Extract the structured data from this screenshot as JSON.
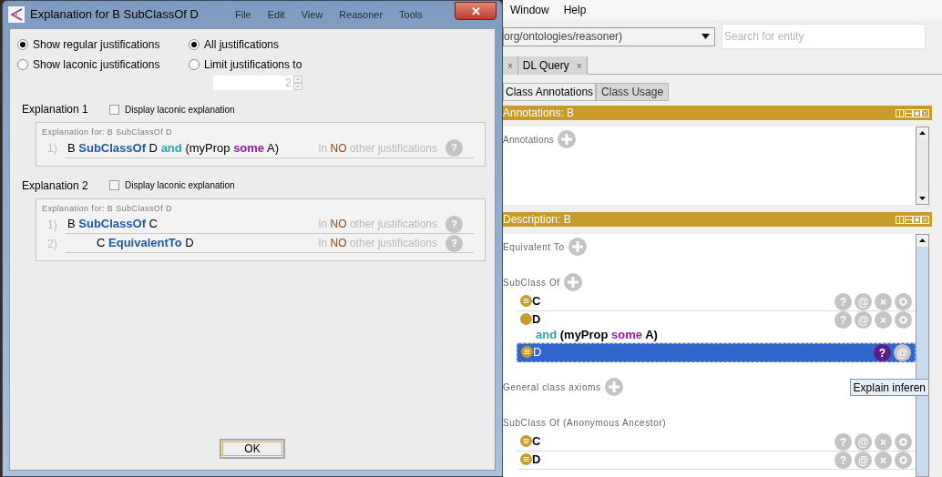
{
  "dialog": {
    "title": "Explanation for B SubClassOf D",
    "close_glyph": "✕",
    "background_menu": [
      "File",
      "Edit",
      "View",
      "Reasoner",
      "Tools"
    ],
    "options": [
      {
        "label": "Show regular justifications",
        "selected": true
      },
      {
        "label": "Show laconic justifications",
        "selected": false
      }
    ],
    "limits": [
      {
        "label": "All justifications",
        "selected": true
      },
      {
        "label": "Limit justifications to",
        "selected": false
      }
    ],
    "limit_value": "2",
    "explanations": [
      {
        "title": "Explanation 1",
        "laconic_label": "Display laconic explanation",
        "laconic_checked": false,
        "header": "Explanation for: B SubClassOf D",
        "axioms": [
          {
            "number": "1)",
            "parts": [
              {
                "text": "B",
                "kind": "name"
              },
              {
                "text": "SubClassOf",
                "kind": "keyword"
              },
              {
                "text": "D",
                "kind": "name"
              },
              {
                "text": "and",
                "kind": "and"
              },
              {
                "text": "(myProp",
                "kind": "name"
              },
              {
                "text": "some",
                "kind": "some"
              },
              {
                "text": "A)",
                "kind": "name"
              }
            ],
            "note": [
              "In",
              "NO",
              "other justifications"
            ],
            "help": "?"
          }
        ]
      },
      {
        "title": "Explanation 2",
        "laconic_label": "Display laconic explanation",
        "laconic_checked": false,
        "header": "Explanation for: B SubClassOf D",
        "axioms": [
          {
            "number": "1)",
            "parts": [
              {
                "text": "B",
                "kind": "name"
              },
              {
                "text": "SubClassOf",
                "kind": "keyword"
              },
              {
                "text": "C",
                "kind": "name"
              }
            ],
            "note": [
              "In",
              "NO",
              "other justifications"
            ],
            "help": "?",
            "children": [
              {
                "number": "2)",
                "parts": [
                  {
                    "text": "C",
                    "kind": "name"
                  },
                  {
                    "text": "EquivalentTo",
                    "kind": "keyword"
                  },
                  {
                    "text": "D",
                    "kind": "name"
                  }
                ],
                "note": [
                  "In",
                  "NO",
                  "other justifications"
                ],
                "help": "?"
              }
            ]
          }
        ]
      }
    ],
    "ok_button": "OK"
  },
  "app": {
    "menu": [
      "Window",
      "Help"
    ],
    "ontology": "org/ontologies/reasoner)",
    "search": {
      "placeholder": "Search for entity"
    },
    "tabs": [
      {
        "close": "×"
      },
      {
        "label": "DL Query",
        "close": "×"
      }
    ],
    "subtabs": [
      {
        "label": "Class Annotations",
        "selected": true
      },
      {
        "label": "Class Usage",
        "selected": false
      }
    ],
    "annotations": {
      "title": "Annotations: B",
      "label": "Annotations"
    },
    "description": {
      "title": "Description: B",
      "sections": [
        {
          "label": "Equivalent To"
        },
        {
          "label": "SubClass Of",
          "items": [
            {
              "kind": "equivalent",
              "selected": false,
              "lines": [
                [
                  {
                    "text": "C",
                    "kind": "name"
                  }
                ]
              ],
              "buttons": [
                {
                  "kind": "explain",
                  "glyph": "?",
                  "highlighted": false
                },
                {
                  "kind": "annotate",
                  "glyph": "@",
                  "highlighted": false
                },
                {
                  "kind": "delete",
                  "glyph": "×",
                  "highlighted": false
                },
                {
                  "kind": "edit",
                  "highlighted": false
                }
              ]
            },
            {
              "kind": "plain",
              "selected": false,
              "lines": [
                [
                  {
                    "text": "D",
                    "kind": "name"
                  }
                ],
                [
                  {
                    "text": "and",
                    "kind": "and"
                  },
                  {
                    "text": "(myProp",
                    "kind": "name"
                  },
                  {
                    "text": "some",
                    "kind": "some"
                  },
                  {
                    "text": "A)",
                    "kind": "name"
                  }
                ]
              ],
              "buttons": [
                {
                  "kind": "explain",
                  "glyph": "?",
                  "highlighted": false
                },
                {
                  "kind": "annotate",
                  "glyph": "@",
                  "highlighted": false
                },
                {
                  "kind": "delete",
                  "glyph": "×",
                  "highlighted": false
                },
                {
                  "kind": "edit",
                  "highlighted": false
                }
              ]
            },
            {
              "kind": "equivalent",
              "selected": true,
              "lines": [
                [
                  {
                    "text": "D",
                    "kind": "name"
                  }
                ]
              ],
              "buttons": [
                {
                  "kind": "explain",
                  "glyph": "?",
                  "highlighted": true
                },
                {
                  "kind": "annotate",
                  "glyph": "@",
                  "highlighted": false
                }
              ]
            }
          ]
        },
        {
          "label": "General class axioms"
        },
        {
          "label": "SubClass Of (Anonymous Ancestor)",
          "items": [
            {
              "kind": "equivalent",
              "selected": false,
              "lines": [
                [
                  {
                    "text": "C",
                    "kind": "name"
                  }
                ]
              ],
              "buttons": [
                {
                  "kind": "explain",
                  "glyph": "?",
                  "highlighted": false
                },
                {
                  "kind": "annotate",
                  "glyph": "@",
                  "highlighted": false
                },
                {
                  "kind": "delete",
                  "glyph": "×",
                  "highlighted": false
                },
                {
                  "kind": "edit",
                  "highlighted": false
                }
              ]
            },
            {
              "kind": "equivalent",
              "selected": false,
              "lines": [
                [
                  {
                    "text": "D",
                    "kind": "name"
                  }
                ]
              ],
              "buttons": [
                {
                  "kind": "explain",
                  "glyph": "?",
                  "highlighted": false
                },
                {
                  "kind": "annotate",
                  "glyph": "@",
                  "highlighted": false
                },
                {
                  "kind": "delete",
                  "glyph": "×",
                  "highlighted": false
                },
                {
                  "kind": "edit",
                  "highlighted": false
                }
              ]
            }
          ]
        }
      ]
    },
    "tooltip": "Explain inferen"
  }
}
